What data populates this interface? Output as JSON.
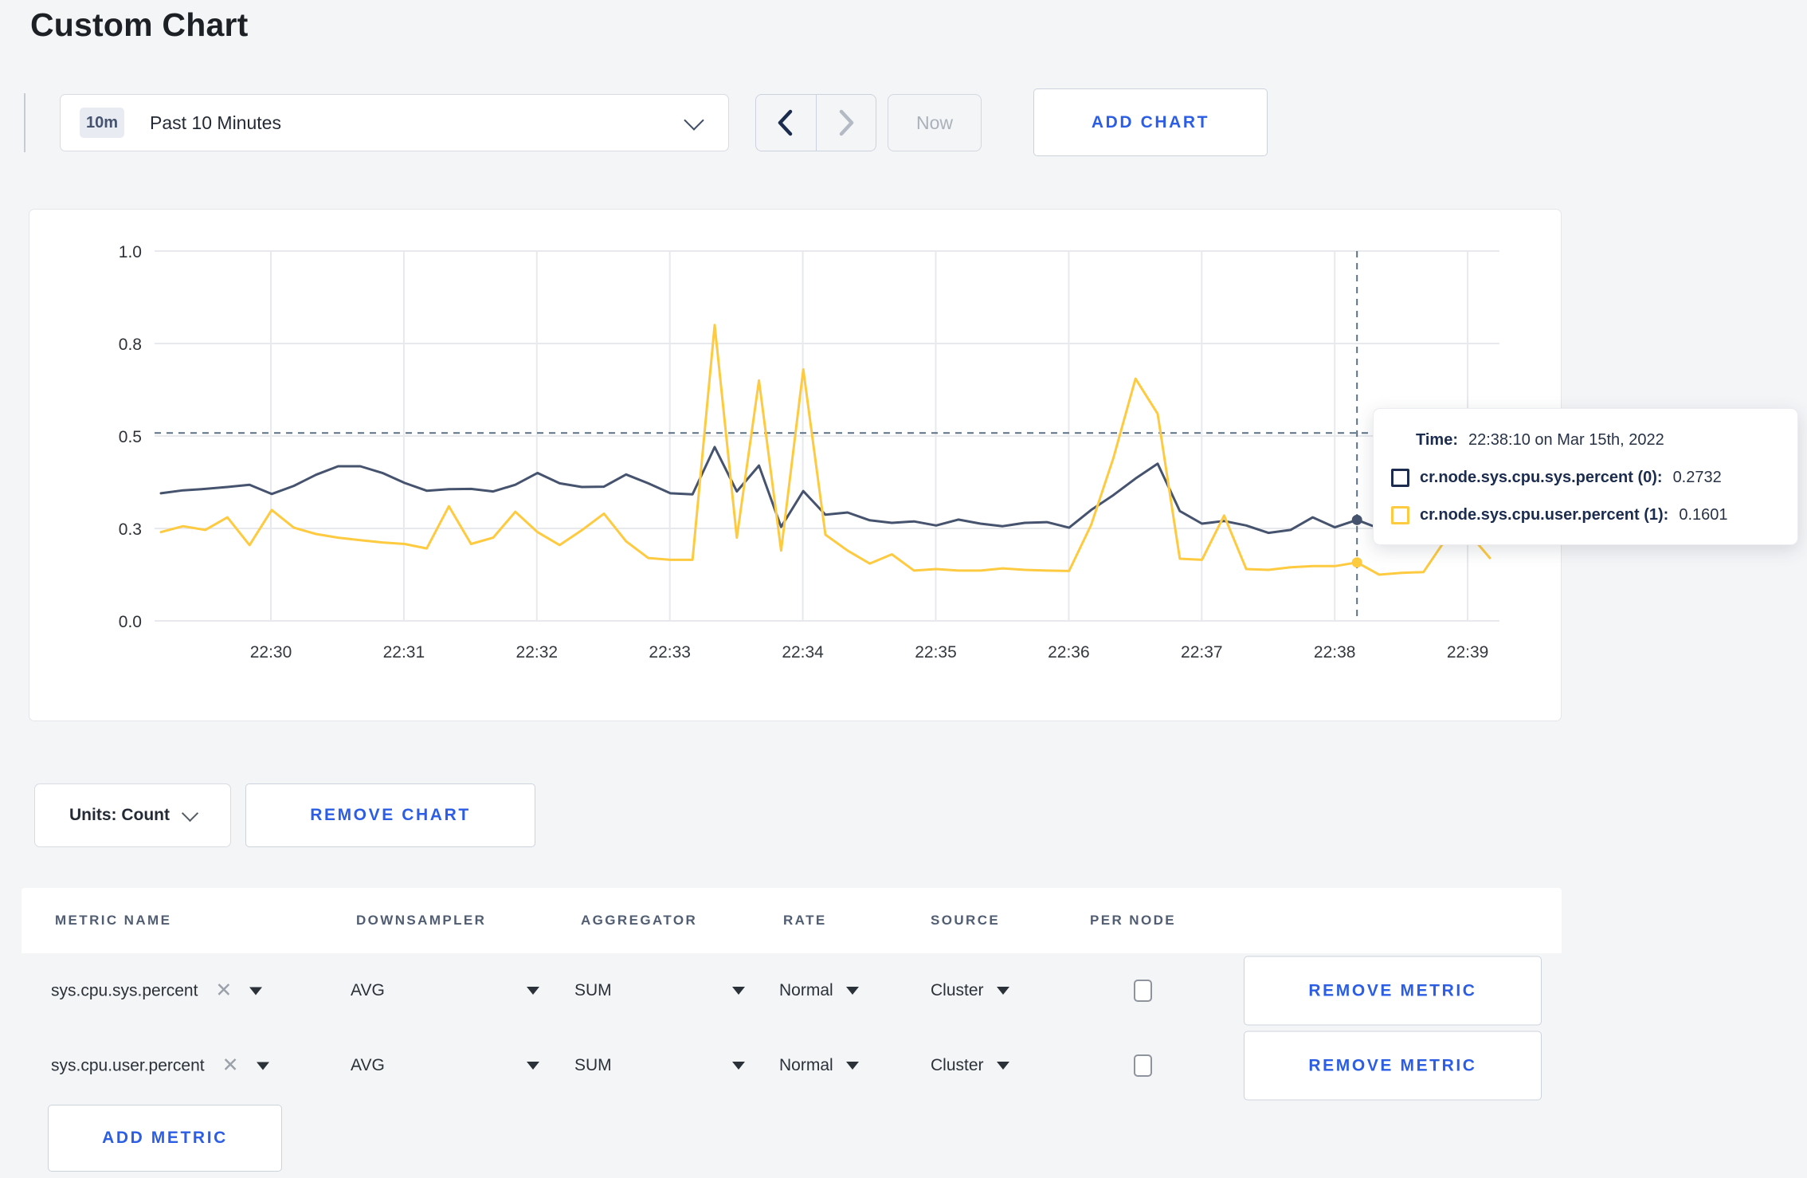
{
  "page": {
    "title": "Custom Chart"
  },
  "toolbar": {
    "time_window_badge": "10m",
    "time_window_label": "Past 10 Minutes",
    "now_label": "Now",
    "add_chart_label": "ADD CHART"
  },
  "colors": {
    "accent_blue": "#2c5de5",
    "series_sys": "#46536e",
    "series_user": "#fdca40",
    "crosshair": "#5c7186",
    "grid": "#e7e9ec"
  },
  "tooltip": {
    "time_label": "Time:",
    "time_value": "22:38:10 on Mar 15th, 2022",
    "series": [
      {
        "label": "cr.node.sys.cpu.sys.percent (0):",
        "value": "0.2732",
        "swatch_color": "#1b2c4e"
      },
      {
        "label": "cr.node.sys.cpu.user.percent (1):",
        "value": "0.1601",
        "swatch_color": "#fdca40"
      }
    ]
  },
  "chart_data": {
    "type": "line",
    "title": "",
    "xlabel": "",
    "ylabel": "",
    "ylim": [
      0,
      1
    ],
    "grid": true,
    "legend_position": "tooltip",
    "x_start": "22:29:10",
    "x_end": "22:39:10",
    "x_step_seconds": 10,
    "x_ticks": [
      "22:30",
      "22:31",
      "22:32",
      "22:33",
      "22:34",
      "22:35",
      "22:36",
      "22:37",
      "22:38",
      "22:39"
    ],
    "y_ticks": [
      {
        "value": 0.0,
        "label": "0.0"
      },
      {
        "value": 0.25,
        "label": "0.3"
      },
      {
        "value": 0.5,
        "label": "0.5"
      },
      {
        "value": 0.75,
        "label": "0.8"
      },
      {
        "value": 1.0,
        "label": "1.0"
      }
    ],
    "series": [
      {
        "name": "cr.node.sys.cpu.sys.percent",
        "color": "#46536e",
        "values": [
          0.345,
          0.353,
          0.357,
          0.362,
          0.368,
          0.343,
          0.365,
          0.395,
          0.418,
          0.418,
          0.4,
          0.373,
          0.352,
          0.356,
          0.357,
          0.35,
          0.368,
          0.4,
          0.372,
          0.362,
          0.363,
          0.396,
          0.372,
          0.345,
          0.342,
          0.47,
          0.35,
          0.42,
          0.254,
          0.351,
          0.287,
          0.293,
          0.272,
          0.265,
          0.269,
          0.258,
          0.274,
          0.263,
          0.256,
          0.265,
          0.267,
          0.252,
          0.3,
          0.34,
          0.385,
          0.425,
          0.297,
          0.263,
          0.27,
          0.258,
          0.238,
          0.246,
          0.28,
          0.253,
          0.273,
          0.25,
          0.26,
          0.27,
          0.28,
          0.285,
          0.29
        ]
      },
      {
        "name": "cr.node.sys.cpu.user.percent",
        "color": "#fdca40",
        "values": [
          0.24,
          0.256,
          0.246,
          0.28,
          0.205,
          0.3,
          0.252,
          0.235,
          0.225,
          0.218,
          0.212,
          0.208,
          0.196,
          0.31,
          0.208,
          0.225,
          0.295,
          0.24,
          0.205,
          0.245,
          0.29,
          0.215,
          0.17,
          0.165,
          0.165,
          0.8,
          0.225,
          0.65,
          0.19,
          0.68,
          0.233,
          0.19,
          0.155,
          0.18,
          0.136,
          0.14,
          0.136,
          0.136,
          0.142,
          0.138,
          0.136,
          0.135,
          0.26,
          0.44,
          0.655,
          0.56,
          0.168,
          0.165,
          0.285,
          0.14,
          0.138,
          0.145,
          0.148,
          0.148,
          0.158,
          0.125,
          0.13,
          0.132,
          0.22,
          0.24,
          0.17
        ]
      }
    ],
    "crosshair": {
      "time": "22:38:10",
      "point_index": 54,
      "h_value": 0.508
    }
  },
  "chart_controls": {
    "units_button_label": "Units: Count",
    "remove_chart_label": "REMOVE CHART"
  },
  "metrics_table": {
    "headers": [
      "METRIC NAME",
      "DOWNSAMPLER",
      "AGGREGATOR",
      "RATE",
      "SOURCE",
      "PER NODE"
    ],
    "rows": [
      {
        "metric": "sys.cpu.sys.percent",
        "downsampler": "AVG",
        "aggregator": "SUM",
        "rate": "Normal",
        "source": "Cluster",
        "per_node_checked": false
      },
      {
        "metric": "sys.cpu.user.percent",
        "downsampler": "AVG",
        "aggregator": "SUM",
        "rate": "Normal",
        "source": "Cluster",
        "per_node_checked": false
      }
    ],
    "remove_metric_label": "REMOVE METRIC",
    "add_metric_label": "ADD METRIC"
  }
}
